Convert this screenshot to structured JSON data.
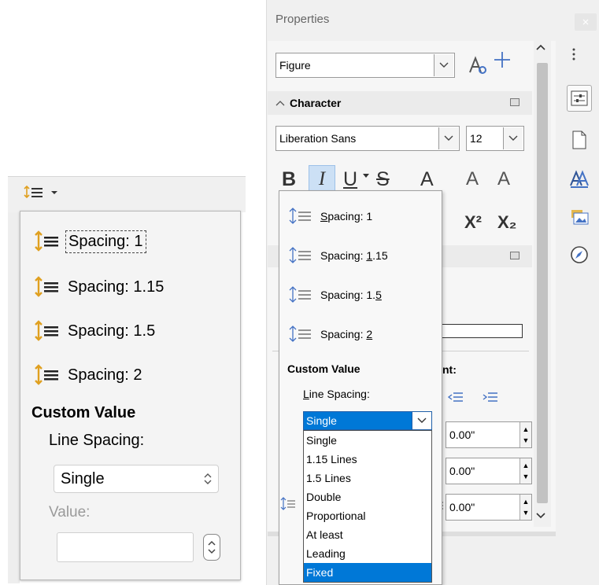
{
  "left_popup": {
    "items": [
      {
        "label": "Spacing: 1"
      },
      {
        "label": "Spacing: 1.15"
      },
      {
        "label": "Spacing: 1.5"
      },
      {
        "label": "Spacing: 2"
      }
    ],
    "custom_value_label": "Custom Value",
    "line_spacing_label": "Line Spacing:",
    "line_spacing_value": "Single",
    "value_label": "Value:",
    "value_input": ""
  },
  "properties": {
    "title": "Properties",
    "style_name": "Figure",
    "character_header": "Character",
    "font_name": "Liberation Sans",
    "font_size": "12",
    "bold_glyph": "B",
    "italic_glyph": "I",
    "underline_glyph": "U",
    "strike_glyph": "S",
    "shadow_glyph": "A",
    "grow_glyph": "A",
    "shrink_glyph": "A",
    "superscript_glyph": "X²",
    "subscript_glyph": "X₂",
    "indent_label": "nt:",
    "spacing_values": [
      "0.00\"",
      "0.00\"",
      "0.00\""
    ]
  },
  "line_spacing_popup": {
    "items": [
      {
        "prefix": "",
        "mnemonic": "S",
        "rest": "pacing: 1"
      },
      {
        "prefix": "Spacing: ",
        "mnemonic": "1",
        "rest": ".15"
      },
      {
        "prefix": "Spacing: 1.",
        "mnemonic": "5",
        "rest": ""
      },
      {
        "prefix": "Spacing: ",
        "mnemonic": "2",
        "rest": ""
      }
    ],
    "custom_value_label": "Custom Value",
    "line_spacing_mnemonic": "L",
    "line_spacing_rest": "ine Spacing:",
    "selected": "Single",
    "options": [
      "Single",
      "1.15 Lines",
      "1.5 Lines",
      "Double",
      "Proportional",
      "At least",
      "Leading",
      "Fixed"
    ],
    "highlighted_option": "Fixed"
  },
  "colors": {
    "accent": "#0078d7",
    "icon_orange": "#e0a020"
  }
}
